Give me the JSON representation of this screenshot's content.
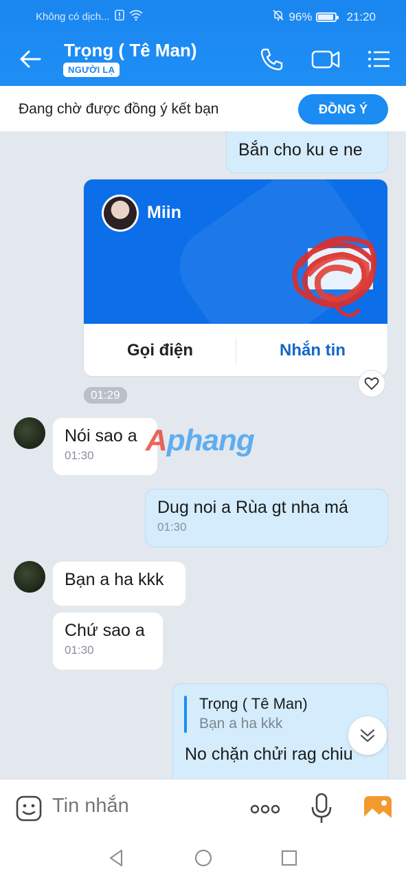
{
  "status_bar": {
    "carrier": "Không có dịch...",
    "battery": "96%",
    "time": "21:20"
  },
  "header": {
    "title": "Trọng ( Tê Man)",
    "tag": "NGƯỜI LẠ",
    "icons": [
      "back-arrow-icon",
      "phone-icon",
      "video-call-icon",
      "menu-list-icon"
    ]
  },
  "friend_request": {
    "text": "Đang chờ được đồng ý kết bạn",
    "button": "ĐỒNG Ý"
  },
  "messages": {
    "m1": {
      "text": "Bắn cho ku e ne"
    },
    "card": {
      "name": "Miin",
      "call": "Gọi điện",
      "message": "Nhắn tin",
      "call_color": "#222222",
      "message_color": "#1565c8"
    },
    "card_time": "01:29",
    "m2": {
      "text": "Nói sao a",
      "time": "01:30"
    },
    "m3": {
      "text": "Dug noi a Rùa gt nha má",
      "time": "01:30"
    },
    "m4": {
      "text": "Bạn a ha kkk"
    },
    "m5": {
      "text": "Chứ sao a",
      "time": "01:30"
    },
    "m6": {
      "quote_name": "Trọng ( Tê Man)",
      "quote_text": "Bạn a ha kkk",
      "text": "No chặn chửi rag chiu"
    }
  },
  "watermark": {
    "a": "A",
    "rest": "phang"
  },
  "input": {
    "placeholder": "Tin nhắn"
  },
  "colors": {
    "header": "#1a86f0",
    "accent": "#1a8cf2",
    "my_bubble": "#d4ecfc",
    "their_bubble": "#ffffff",
    "chat_bg": "#e3e8ef"
  }
}
